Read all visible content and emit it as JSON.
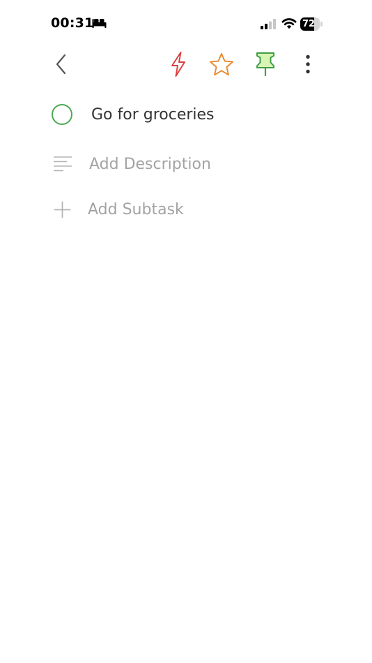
{
  "status_bar": {
    "time": "00:31",
    "battery_level": "72",
    "battery_fraction": 0.72,
    "icons": [
      "bed-icon",
      "cellular-signal-icon",
      "wifi-icon",
      "battery-icon"
    ]
  },
  "toolbar": {
    "icons": [
      "chevron-left-icon",
      "lightning-icon",
      "star-icon",
      "pin-icon",
      "more-vertical-icon"
    ]
  },
  "task": {
    "title": "Go for groceries",
    "completed": false
  },
  "description": {
    "placeholder": "Add Description"
  },
  "subtask": {
    "label": "Add Subtask"
  },
  "colors": {
    "checkbox": "#4caa54",
    "lightning": "#dc3d3d",
    "star": "#e8892e",
    "pin_stroke": "#3f9e47",
    "pin_fill": "#d8f5b4",
    "placeholder_text": "#a3a3a3",
    "title_text": "#333333"
  }
}
